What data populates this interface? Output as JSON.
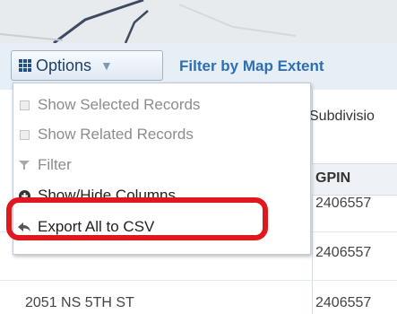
{
  "toolbar": {
    "options_label": "Options",
    "filter_map_label": "Filter by Map Extent"
  },
  "table": {
    "subdivision_header": "Subdivisio",
    "gpin_header": "GPIN",
    "rows": [
      {
        "address": "",
        "gpin": "2406557"
      },
      {
        "address": "",
        "gpin": "2406557"
      },
      {
        "address": "2051 NS 5TH ST",
        "gpin": "2406557"
      }
    ]
  },
  "menu": {
    "items": [
      {
        "label": "Show Selected Records",
        "enabled": false,
        "icon": "checkbox-icon"
      },
      {
        "label": "Show Related Records",
        "enabled": false,
        "icon": "checkbox-icon"
      },
      {
        "label": "Filter",
        "enabled": false,
        "icon": "filter-icon"
      },
      {
        "label": "Show/Hide Columns",
        "enabled": true,
        "icon": "plus-circle-icon"
      },
      {
        "label": "Export All to CSV",
        "enabled": true,
        "icon": "export-arrow-icon"
      }
    ]
  },
  "colors": {
    "highlight": "#e1171e",
    "link": "#2d6fb3",
    "toolbar_bg": "#e6eef6"
  }
}
